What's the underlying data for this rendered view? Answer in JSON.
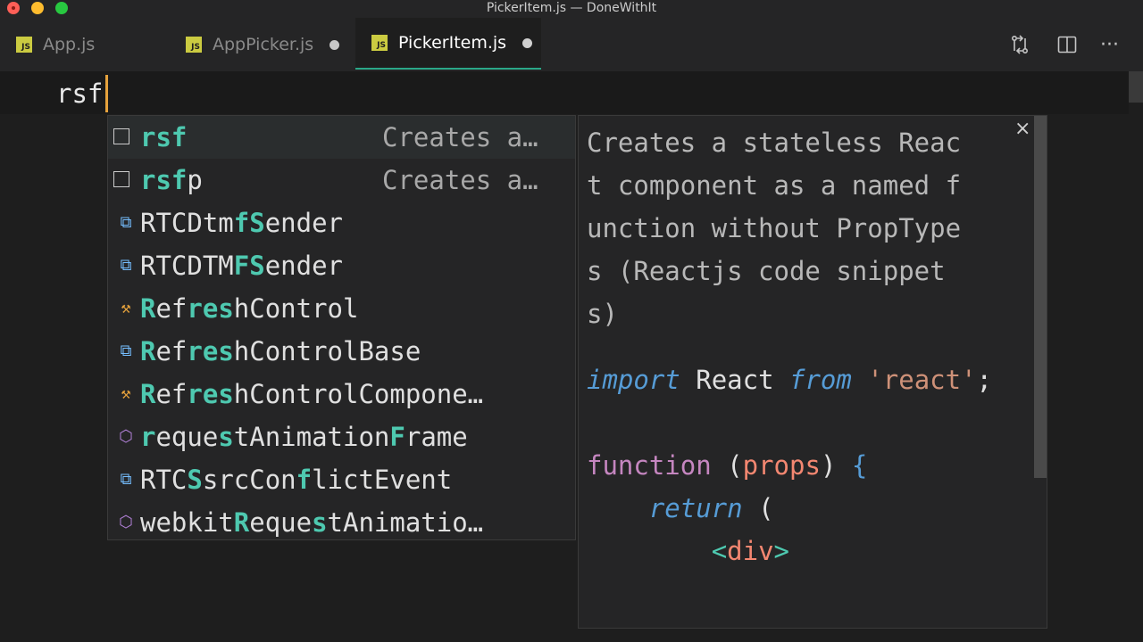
{
  "window": {
    "title": "PickerItem.js — DoneWithIt"
  },
  "tabs": [
    {
      "icon": "JS",
      "label": "App.js",
      "active": false,
      "dirty": false
    },
    {
      "icon": "JS",
      "label": "AppPicker.js",
      "active": false,
      "dirty": true
    },
    {
      "icon": "JS",
      "label": "PickerItem.js",
      "active": true,
      "dirty": true
    }
  ],
  "toolbar": {
    "icons": [
      "compare-changes-icon",
      "split-editor-icon",
      "more-actions-icon"
    ],
    "more_glyph": "···"
  },
  "editor": {
    "typed_text": "rsf"
  },
  "suggestions": [
    {
      "icon": "snippet-icon",
      "match": "rsf",
      "rest": "",
      "detail": "Creates a…"
    },
    {
      "icon": "snippet-icon",
      "match": "rsf",
      "rest": "p",
      "detail": "Creates a…"
    },
    {
      "icon": "class-icon",
      "parts": [
        "RTCDtm",
        "fS",
        "ender"
      ]
    },
    {
      "icon": "class-icon",
      "parts": [
        "RTCDTM",
        "FS",
        "ender"
      ]
    },
    {
      "icon": "property-icon",
      "parts": [
        "R",
        "ef",
        "re",
        "s",
        "hControl"
      ]
    },
    {
      "icon": "class-icon",
      "parts": [
        "R",
        "ef",
        "re",
        "s",
        "hControlBase"
      ]
    },
    {
      "icon": "property-icon",
      "parts": [
        "R",
        "ef",
        "re",
        "s",
        "hControlCompone…"
      ]
    },
    {
      "icon": "method-icon",
      "parts": [
        "",
        "r",
        "eque",
        "s",
        "tAnimation",
        "F",
        "rame"
      ]
    },
    {
      "icon": "class-icon",
      "parts": [
        "RTC",
        "S",
        "srcCon",
        "f",
        "lictEvent"
      ]
    },
    {
      "icon": "method-icon",
      "parts": [
        "webkit",
        "R",
        "eque",
        "s",
        "tAnimatio…"
      ]
    }
  ],
  "details": {
    "close_glyph": "×",
    "description_lines": [
      "Creates a stateless Reac",
      "t component as a named f",
      "unction without PropType",
      "s (Reactjs code snippet",
      "s)"
    ],
    "code": {
      "import_kw": "import",
      "react_ident": "React",
      "from_kw": "from",
      "module_str": "'react'",
      "semicolon": ";",
      "function_kw": "function",
      "open_paren": "(",
      "param": "props",
      "close_paren": ")",
      "open_brace": "{",
      "return_kw": "return",
      "return_paren": "(",
      "tag_open": "<",
      "tag_name": "div",
      "tag_close": ">"
    }
  },
  "colors": {
    "match_highlight": "#4ec9b0",
    "cursor": "#e6a23c",
    "active_tab_border": "#2aa889"
  }
}
